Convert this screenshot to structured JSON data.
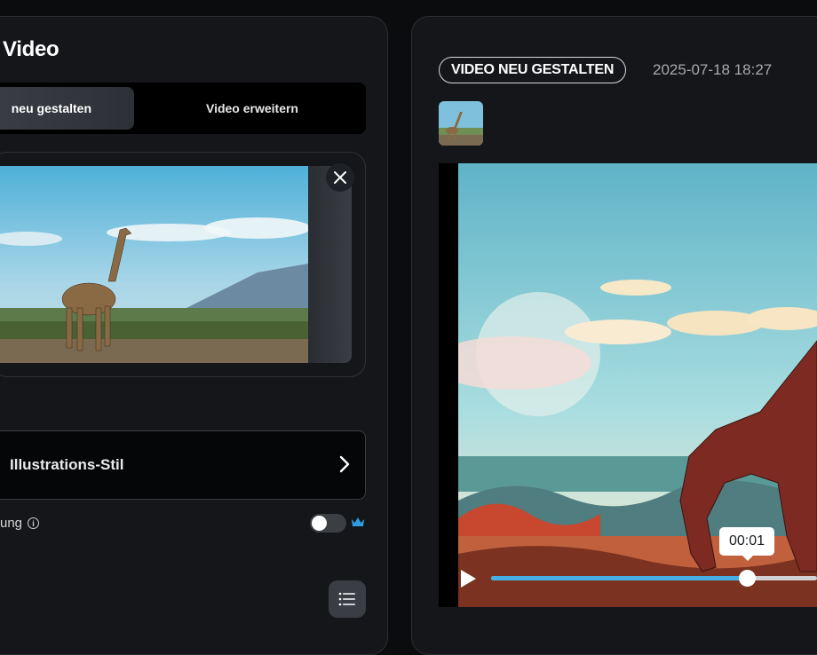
{
  "left_panel": {
    "title": "Video",
    "tabs": [
      {
        "label": "neu gestalten",
        "active": true
      },
      {
        "label": "Video erweitern",
        "active": false
      }
    ],
    "style_option": {
      "label": "Illustrations-Stil"
    },
    "toggle_row": {
      "label": "ung",
      "enabled": false
    }
  },
  "right_panel": {
    "badge": "VIDEO NEU GESTALTEN",
    "timestamp": "2025-07-18 18:27",
    "player": {
      "current_time": "00:01",
      "progress": 0.8
    }
  },
  "colors": {
    "accent": "#45b0e6",
    "panel_bg": "#141619",
    "page_bg": "#0b0c0e",
    "premium": "#2f9be0"
  },
  "icons": [
    "close-icon",
    "chevron-right-icon",
    "info-icon",
    "crown-icon",
    "list-icon",
    "play-icon"
  ]
}
